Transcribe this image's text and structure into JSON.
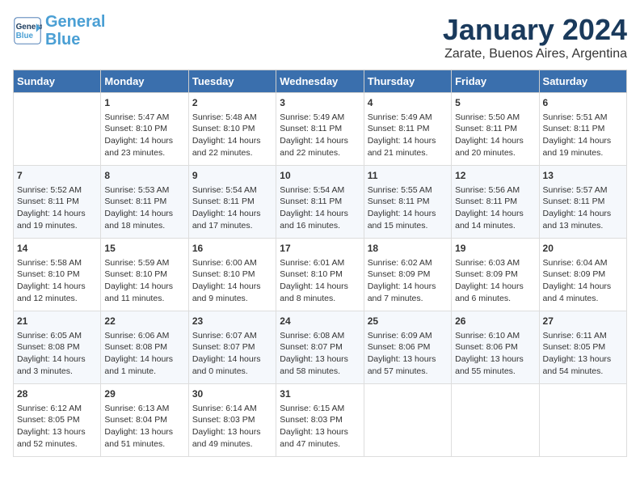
{
  "header": {
    "logo_line1": "General",
    "logo_line2": "Blue",
    "month": "January 2024",
    "location": "Zarate, Buenos Aires, Argentina"
  },
  "days_of_week": [
    "Sunday",
    "Monday",
    "Tuesday",
    "Wednesday",
    "Thursday",
    "Friday",
    "Saturday"
  ],
  "weeks": [
    [
      {
        "day": "",
        "content": ""
      },
      {
        "day": "1",
        "content": "Sunrise: 5:47 AM\nSunset: 8:10 PM\nDaylight: 14 hours\nand 23 minutes."
      },
      {
        "day": "2",
        "content": "Sunrise: 5:48 AM\nSunset: 8:10 PM\nDaylight: 14 hours\nand 22 minutes."
      },
      {
        "day": "3",
        "content": "Sunrise: 5:49 AM\nSunset: 8:11 PM\nDaylight: 14 hours\nand 22 minutes."
      },
      {
        "day": "4",
        "content": "Sunrise: 5:49 AM\nSunset: 8:11 PM\nDaylight: 14 hours\nand 21 minutes."
      },
      {
        "day": "5",
        "content": "Sunrise: 5:50 AM\nSunset: 8:11 PM\nDaylight: 14 hours\nand 20 minutes."
      },
      {
        "day": "6",
        "content": "Sunrise: 5:51 AM\nSunset: 8:11 PM\nDaylight: 14 hours\nand 19 minutes."
      }
    ],
    [
      {
        "day": "7",
        "content": "Sunrise: 5:52 AM\nSunset: 8:11 PM\nDaylight: 14 hours\nand 19 minutes."
      },
      {
        "day": "8",
        "content": "Sunrise: 5:53 AM\nSunset: 8:11 PM\nDaylight: 14 hours\nand 18 minutes."
      },
      {
        "day": "9",
        "content": "Sunrise: 5:54 AM\nSunset: 8:11 PM\nDaylight: 14 hours\nand 17 minutes."
      },
      {
        "day": "10",
        "content": "Sunrise: 5:54 AM\nSunset: 8:11 PM\nDaylight: 14 hours\nand 16 minutes."
      },
      {
        "day": "11",
        "content": "Sunrise: 5:55 AM\nSunset: 8:11 PM\nDaylight: 14 hours\nand 15 minutes."
      },
      {
        "day": "12",
        "content": "Sunrise: 5:56 AM\nSunset: 8:11 PM\nDaylight: 14 hours\nand 14 minutes."
      },
      {
        "day": "13",
        "content": "Sunrise: 5:57 AM\nSunset: 8:11 PM\nDaylight: 14 hours\nand 13 minutes."
      }
    ],
    [
      {
        "day": "14",
        "content": "Sunrise: 5:58 AM\nSunset: 8:10 PM\nDaylight: 14 hours\nand 12 minutes."
      },
      {
        "day": "15",
        "content": "Sunrise: 5:59 AM\nSunset: 8:10 PM\nDaylight: 14 hours\nand 11 minutes."
      },
      {
        "day": "16",
        "content": "Sunrise: 6:00 AM\nSunset: 8:10 PM\nDaylight: 14 hours\nand 9 minutes."
      },
      {
        "day": "17",
        "content": "Sunrise: 6:01 AM\nSunset: 8:10 PM\nDaylight: 14 hours\nand 8 minutes."
      },
      {
        "day": "18",
        "content": "Sunrise: 6:02 AM\nSunset: 8:09 PM\nDaylight: 14 hours\nand 7 minutes."
      },
      {
        "day": "19",
        "content": "Sunrise: 6:03 AM\nSunset: 8:09 PM\nDaylight: 14 hours\nand 6 minutes."
      },
      {
        "day": "20",
        "content": "Sunrise: 6:04 AM\nSunset: 8:09 PM\nDaylight: 14 hours\nand 4 minutes."
      }
    ],
    [
      {
        "day": "21",
        "content": "Sunrise: 6:05 AM\nSunset: 8:08 PM\nDaylight: 14 hours\nand 3 minutes."
      },
      {
        "day": "22",
        "content": "Sunrise: 6:06 AM\nSunset: 8:08 PM\nDaylight: 14 hours\nand 1 minute."
      },
      {
        "day": "23",
        "content": "Sunrise: 6:07 AM\nSunset: 8:07 PM\nDaylight: 14 hours\nand 0 minutes."
      },
      {
        "day": "24",
        "content": "Sunrise: 6:08 AM\nSunset: 8:07 PM\nDaylight: 13 hours\nand 58 minutes."
      },
      {
        "day": "25",
        "content": "Sunrise: 6:09 AM\nSunset: 8:06 PM\nDaylight: 13 hours\nand 57 minutes."
      },
      {
        "day": "26",
        "content": "Sunrise: 6:10 AM\nSunset: 8:06 PM\nDaylight: 13 hours\nand 55 minutes."
      },
      {
        "day": "27",
        "content": "Sunrise: 6:11 AM\nSunset: 8:05 PM\nDaylight: 13 hours\nand 54 minutes."
      }
    ],
    [
      {
        "day": "28",
        "content": "Sunrise: 6:12 AM\nSunset: 8:05 PM\nDaylight: 13 hours\nand 52 minutes."
      },
      {
        "day": "29",
        "content": "Sunrise: 6:13 AM\nSunset: 8:04 PM\nDaylight: 13 hours\nand 51 minutes."
      },
      {
        "day": "30",
        "content": "Sunrise: 6:14 AM\nSunset: 8:03 PM\nDaylight: 13 hours\nand 49 minutes."
      },
      {
        "day": "31",
        "content": "Sunrise: 6:15 AM\nSunset: 8:03 PM\nDaylight: 13 hours\nand 47 minutes."
      },
      {
        "day": "",
        "content": ""
      },
      {
        "day": "",
        "content": ""
      },
      {
        "day": "",
        "content": ""
      }
    ]
  ]
}
